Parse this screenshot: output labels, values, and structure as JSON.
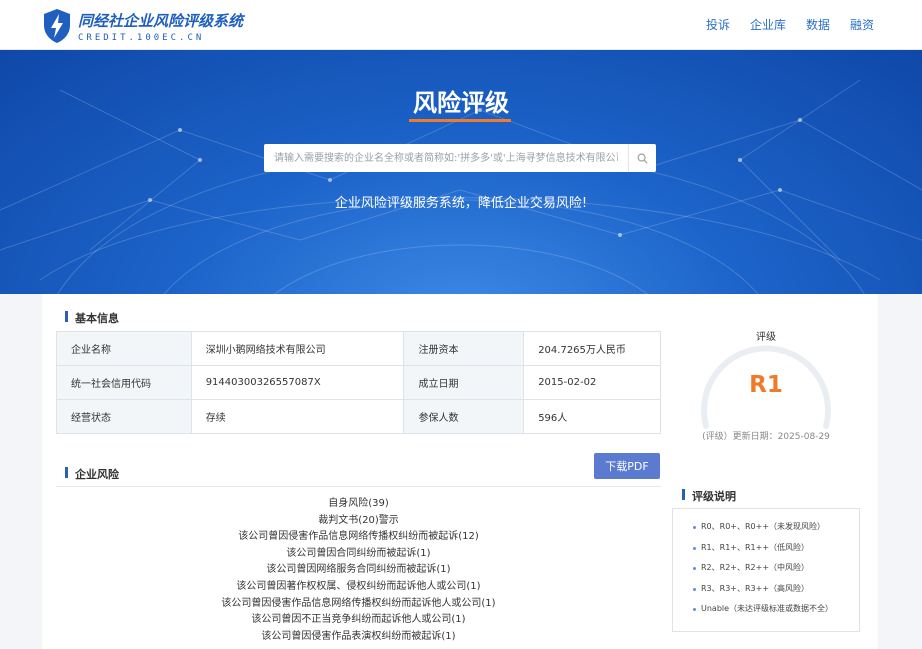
{
  "header": {
    "logo_title": "同经社企业风险评级系统",
    "logo_sub": "CREDIT.100EC.CN",
    "nav": [
      "投诉",
      "企业库",
      "数据",
      "融资"
    ]
  },
  "banner": {
    "title": "风险评级",
    "search_placeholder": "请输入需要搜索的企业名全称或者简称如:'拼多多'或'上海寻梦信息技术有限公司'",
    "slogan": "企业风险评级服务系统，降低企业交易风险!"
  },
  "basic_info": {
    "title": "基本信息",
    "rows": [
      [
        "企业名称",
        "深圳小鹅网络技术有限公司",
        "注册资本",
        "204.7265万人民币"
      ],
      [
        "统一社会信用代码",
        "91440300326557087X",
        "成立日期",
        "2015-02-02"
      ],
      [
        "经营状态",
        "存续",
        "参保人数",
        "596人"
      ]
    ]
  },
  "rating": {
    "label": "评级",
    "value": "R1",
    "date_text": "(评级）更新日期：2025-08-29",
    "accent_color": "#f07a2a"
  },
  "risk": {
    "title": "企业风险",
    "download_label": "下载PDF",
    "items": [
      "自身风险(39)",
      "裁判文书(20)警示",
      "该公司曾因侵害作品信息网络传播权纠纷而被起诉(12)",
      "该公司曾因合同纠纷而被起诉(1)",
      "该公司曾因网络服务合同纠纷而被起诉(1)",
      "该公司曾因著作权权属、侵权纠纷而起诉他人或公司(1)",
      "该公司曾因侵害作品信息网络传播权纠纷而起诉他人或公司(1)",
      "该公司曾因不正当竞争纠纷而起诉他人或公司(1)",
      "该公司曾因侵害作品表演权纠纷而被起诉(1)"
    ]
  },
  "legend": {
    "title": "评级说明",
    "items": [
      "R0、R0+、R0++（未发现风险）",
      "R1、R1+、R1++（低风险）",
      "R2、R2+、R2++（中风险）",
      "R3、R3+、R3++（高风险）",
      "Unable（未达评级标准或数据不全）"
    ]
  }
}
